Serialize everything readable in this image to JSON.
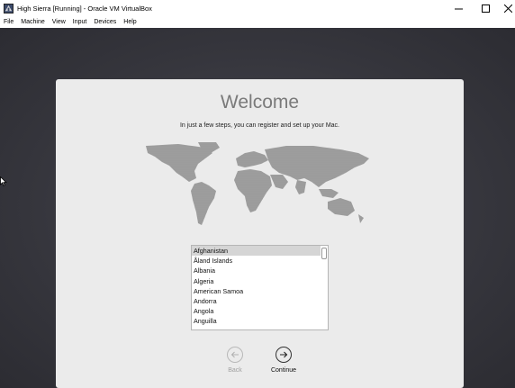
{
  "window": {
    "title": "High Sierra [Running] - Oracle VM VirtualBox",
    "app_icon": "virtualbox-icon"
  },
  "menubar": {
    "items": [
      "File",
      "Machine",
      "View",
      "Input",
      "Devices",
      "Help"
    ]
  },
  "setup": {
    "heading": "Welcome",
    "subtitle": "In just a few steps, you can register and set up your Mac.",
    "countries": [
      "Afghanistan",
      "Åland Islands",
      "Albania",
      "Algeria",
      "American Samoa",
      "Andorra",
      "Angola",
      "Anguilla"
    ],
    "selected_country": "Afghanistan",
    "back_label": "Back",
    "continue_label": "Continue"
  },
  "colors": {
    "background_dark": "#36363d",
    "panel": "#ebebeb",
    "heading": "#7a7a7a",
    "map_dots": "#9a9a9a"
  }
}
